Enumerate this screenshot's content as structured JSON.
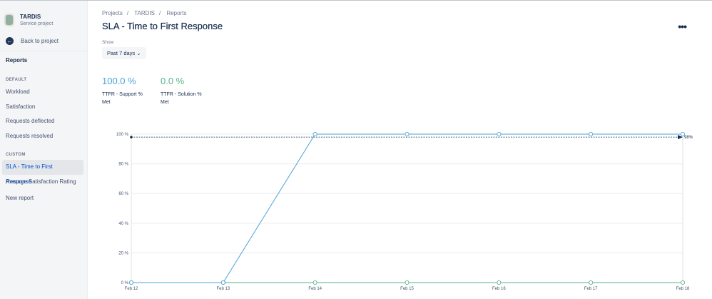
{
  "sidebar": {
    "project_name": "TARDIS",
    "project_type": "Service project",
    "back_label": "Back to project",
    "reports_label": "Reports",
    "default_header": "DEFAULT",
    "default_items": [
      "Workload",
      "Satisfaction",
      "Requests deflected",
      "Requests resolved"
    ],
    "custom_header": "CUSTOM",
    "custom_items": [
      "SLA - Time to First Response",
      "Average Satisfaction Rating"
    ],
    "new_report": "New report"
  },
  "breadcrumbs": [
    "Projects",
    "TARDIS",
    "Reports"
  ],
  "page_title": "SLA - Time to First Response",
  "more_label": "•••",
  "filter": {
    "label": "Show",
    "value": "Past 7 days"
  },
  "stats": [
    {
      "value": "100.0 %",
      "label": "TTFR - Support % Met",
      "color": "#4aa3d8"
    },
    {
      "value": "0.0 %",
      "label": "TTFR - Solution % Met",
      "color": "#57b38a"
    }
  ],
  "chart_data": {
    "type": "line",
    "x": [
      "Feb 12",
      "Feb 13",
      "Feb 14",
      "Feb 15",
      "Feb 16",
      "Feb 17",
      "Feb 18"
    ],
    "yticks": [
      "0 %",
      "20 %",
      "40 %",
      "60 %",
      "80 %",
      "100 %"
    ],
    "ylim": [
      0,
      100
    ],
    "series": [
      {
        "name": "TTFR - Support % Met",
        "color": "#4aa3d8",
        "values": [
          0,
          0,
          100,
          100,
          100,
          100,
          100
        ]
      },
      {
        "name": "TTFR - Solution % Met",
        "color": "#57b38a",
        "values": [
          0,
          0,
          0,
          0,
          0,
          0,
          0
        ]
      }
    ],
    "target": {
      "value": 98,
      "label": "98%"
    }
  }
}
